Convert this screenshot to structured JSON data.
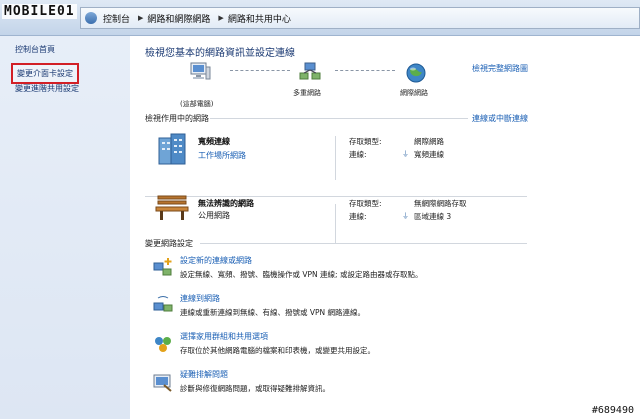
{
  "watermark_logo": "MOBILE01",
  "breadcrumb": [
    "控制台",
    "網路和網際網路",
    "網路和共用中心"
  ],
  "left_nav": {
    "home": "控制台首頁",
    "adapter": "變更介面卡設定",
    "advanced": "變更進階共用設定"
  },
  "main": {
    "title": "檢視您基本的網路資訊並設定連線",
    "full_map_link": "檢視完整網路圖",
    "map": {
      "this_pc": "(這部電腦)",
      "multi_network": "多重網路",
      "internet": "網際網路"
    },
    "active_header": "檢視作用中的網路",
    "connect_link": "連線或中斷連線",
    "networks": [
      {
        "name": "寬頻連線",
        "category": "工作場所網路",
        "access_label": "存取類型:",
        "access_value": "網際網路",
        "conn_label": "連線:",
        "conn_value": "寬頻連線"
      },
      {
        "name": "無法辨識的網路",
        "category": "公用網路",
        "access_label": "存取類型:",
        "access_value": "無網際網路存取",
        "conn_label": "連線:",
        "conn_value": "區域連線 3"
      }
    ],
    "change_header": "變更網路設定",
    "tasks": [
      {
        "title": "設定新的連線或網路",
        "desc": "設定無線、寬頻、撥號、臨機操作或 VPN 連線; 或設定路由器或存取點。",
        "icon": "new-connection-icon"
      },
      {
        "title": "連線到網路",
        "desc": "連線或重新連線到無線、有線、撥號或 VPN 網路連線。",
        "icon": "connect-network-icon"
      },
      {
        "title": "選擇家用群組和共用選項",
        "desc": "存取位於其他網路電腦的檔案和印表機，或變更共用設定。",
        "icon": "homegroup-icon"
      },
      {
        "title": "疑難排解問題",
        "desc": "診斷與修復網路問題，或取得疑難排解資訊。",
        "icon": "troubleshoot-icon"
      }
    ]
  },
  "corner_tag": "#689490",
  "colors": {
    "link": "#1a5fb4",
    "title": "#1b3a73",
    "highlight_border": "#d21f26"
  }
}
